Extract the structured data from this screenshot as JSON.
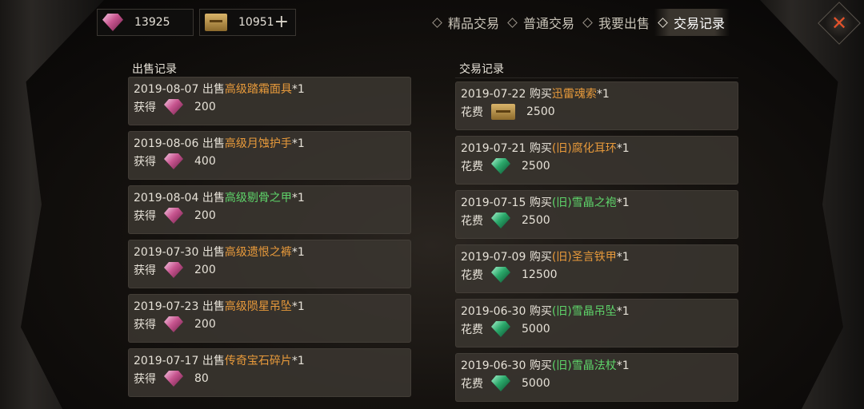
{
  "currency": {
    "gem_amount": "13925",
    "ticket_amount": "10951",
    "add_label": "+"
  },
  "tabs": [
    "精品交易",
    "普通交易",
    "我要出售",
    "交易记录"
  ],
  "sell_records": {
    "title": "出售记录",
    "items": [
      {
        "date": "2019-08-07",
        "verb": "出售",
        "item": "高级踏霜面具",
        "item_color": "orange",
        "qty": "*1",
        "label": "获得",
        "amount": "200"
      },
      {
        "date": "2019-08-06",
        "verb": "出售",
        "item": "高级月蚀护手",
        "item_color": "orange",
        "qty": "*1",
        "label": "获得",
        "amount": "400"
      },
      {
        "date": "2019-08-04",
        "verb": "出售",
        "item": "高级剔骨之甲",
        "item_color": "green",
        "qty": "*1",
        "label": "获得",
        "amount": "200"
      },
      {
        "date": "2019-07-30",
        "verb": "出售",
        "item": "高级遗恨之裤",
        "item_color": "orange",
        "qty": "*1",
        "label": "获得",
        "amount": "200"
      },
      {
        "date": "2019-07-23",
        "verb": "出售",
        "item": "高级陨星吊坠",
        "item_color": "orange",
        "qty": "*1",
        "label": "获得",
        "amount": "200"
      },
      {
        "date": "2019-07-17",
        "verb": "出售",
        "item": "传奇宝石碎片",
        "item_color": "orange",
        "qty": "*1",
        "label": "获得",
        "amount": "80"
      }
    ]
  },
  "trade_records": {
    "title": "交易记录",
    "items": [
      {
        "date": "2019-07-22",
        "verb": "购买",
        "item": "迅雷魂索",
        "item_color": "orange",
        "qty": "*1",
        "label": "花费",
        "amount": "2500",
        "currency": "ticket"
      },
      {
        "date": "2019-07-21",
        "verb": "购买",
        "item": "(旧)腐化耳环",
        "item_color": "orange",
        "qty": "*1",
        "label": "花费",
        "amount": "2500",
        "currency": "emerald"
      },
      {
        "date": "2019-07-15",
        "verb": "购买",
        "item": "(旧)雪晶之袍",
        "item_color": "green",
        "qty": "*1",
        "label": "花费",
        "amount": "2500",
        "currency": "emerald"
      },
      {
        "date": "2019-07-09",
        "verb": "购买",
        "item": "(旧)圣言铁甲",
        "item_color": "orange",
        "qty": "*1",
        "label": "花费",
        "amount": "12500",
        "currency": "emerald"
      },
      {
        "date": "2019-06-30",
        "verb": "购买",
        "item": "(旧)雪晶吊坠",
        "item_color": "green",
        "qty": "*1",
        "label": "花费",
        "amount": "5000",
        "currency": "emerald"
      },
      {
        "date": "2019-06-30",
        "verb": "购买",
        "item": "(旧)雪晶法杖",
        "item_color": "green",
        "qty": "*1",
        "label": "花费",
        "amount": "5000",
        "currency": "emerald"
      }
    ]
  },
  "icons": {
    "gem": "pink-diamond-icon",
    "ticket": "gold-ticket-icon",
    "emerald": "green-emerald-icon",
    "close": "close-icon"
  },
  "colors": {
    "orange": "#e89a3b",
    "green": "#5ed46a",
    "close": "#e3522b"
  }
}
